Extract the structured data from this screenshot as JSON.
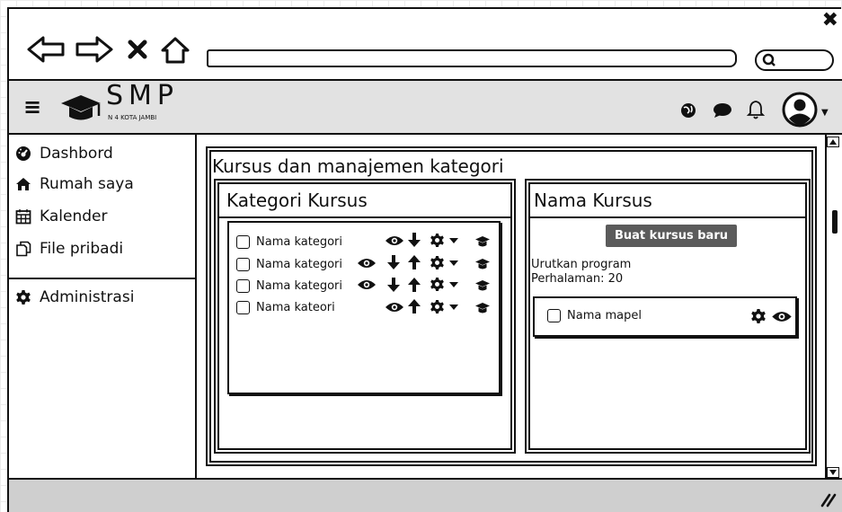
{
  "window": {
    "close_glyph": "✖"
  },
  "browser": {
    "url": "",
    "search_value": ""
  },
  "header": {
    "menu_glyph": "≡",
    "logo_title": "SMP",
    "logo_subtitle": "N 4 KOTA JAMBI",
    "avatar_caret": "▼"
  },
  "sidebar": {
    "items": [
      {
        "label": "Dashbord",
        "icon": "dashboard-icon"
      },
      {
        "label": "Rumah saya",
        "icon": "home-icon"
      },
      {
        "label": "Kalender",
        "icon": "calendar-icon"
      },
      {
        "label": "File pribadi",
        "icon": "files-icon"
      }
    ],
    "admin": {
      "label": "Administrasi",
      "icon": "gear-icon"
    }
  },
  "main": {
    "title": "Kursus dan manajemen kategori"
  },
  "kategori_panel": {
    "title": "Kategori Kursus",
    "rows": [
      {
        "name": "Nama kategori",
        "icons": [
          "eye",
          "down",
          "gear",
          "caret",
          "cap"
        ]
      },
      {
        "name": "Nama kategori",
        "icons": [
          "eye",
          "down",
          "up",
          "gear",
          "caret",
          "cap"
        ]
      },
      {
        "name": "Nama kategori",
        "icons": [
          "eye",
          "down",
          "up",
          "gear",
          "caret",
          "cap"
        ]
      },
      {
        "name": "Nama kateori",
        "icons": [
          "eye",
          "up",
          "gear",
          "caret",
          "cap"
        ]
      }
    ]
  },
  "kursus_panel": {
    "title": "Nama Kursus",
    "create_button": "Buat kursus baru",
    "sort_label": "Urutkan program",
    "per_page_label": "Perhalaman: 20",
    "course_row": {
      "name": "Nama mapel"
    }
  },
  "statusbar": {
    "grip_glyph": "//"
  },
  "colors": {
    "line": "#111111",
    "header_band": "#e2e2e2",
    "statusbar": "#cfcfcf",
    "button_bg": "#5b5b5b",
    "button_text": "#ffffff"
  }
}
